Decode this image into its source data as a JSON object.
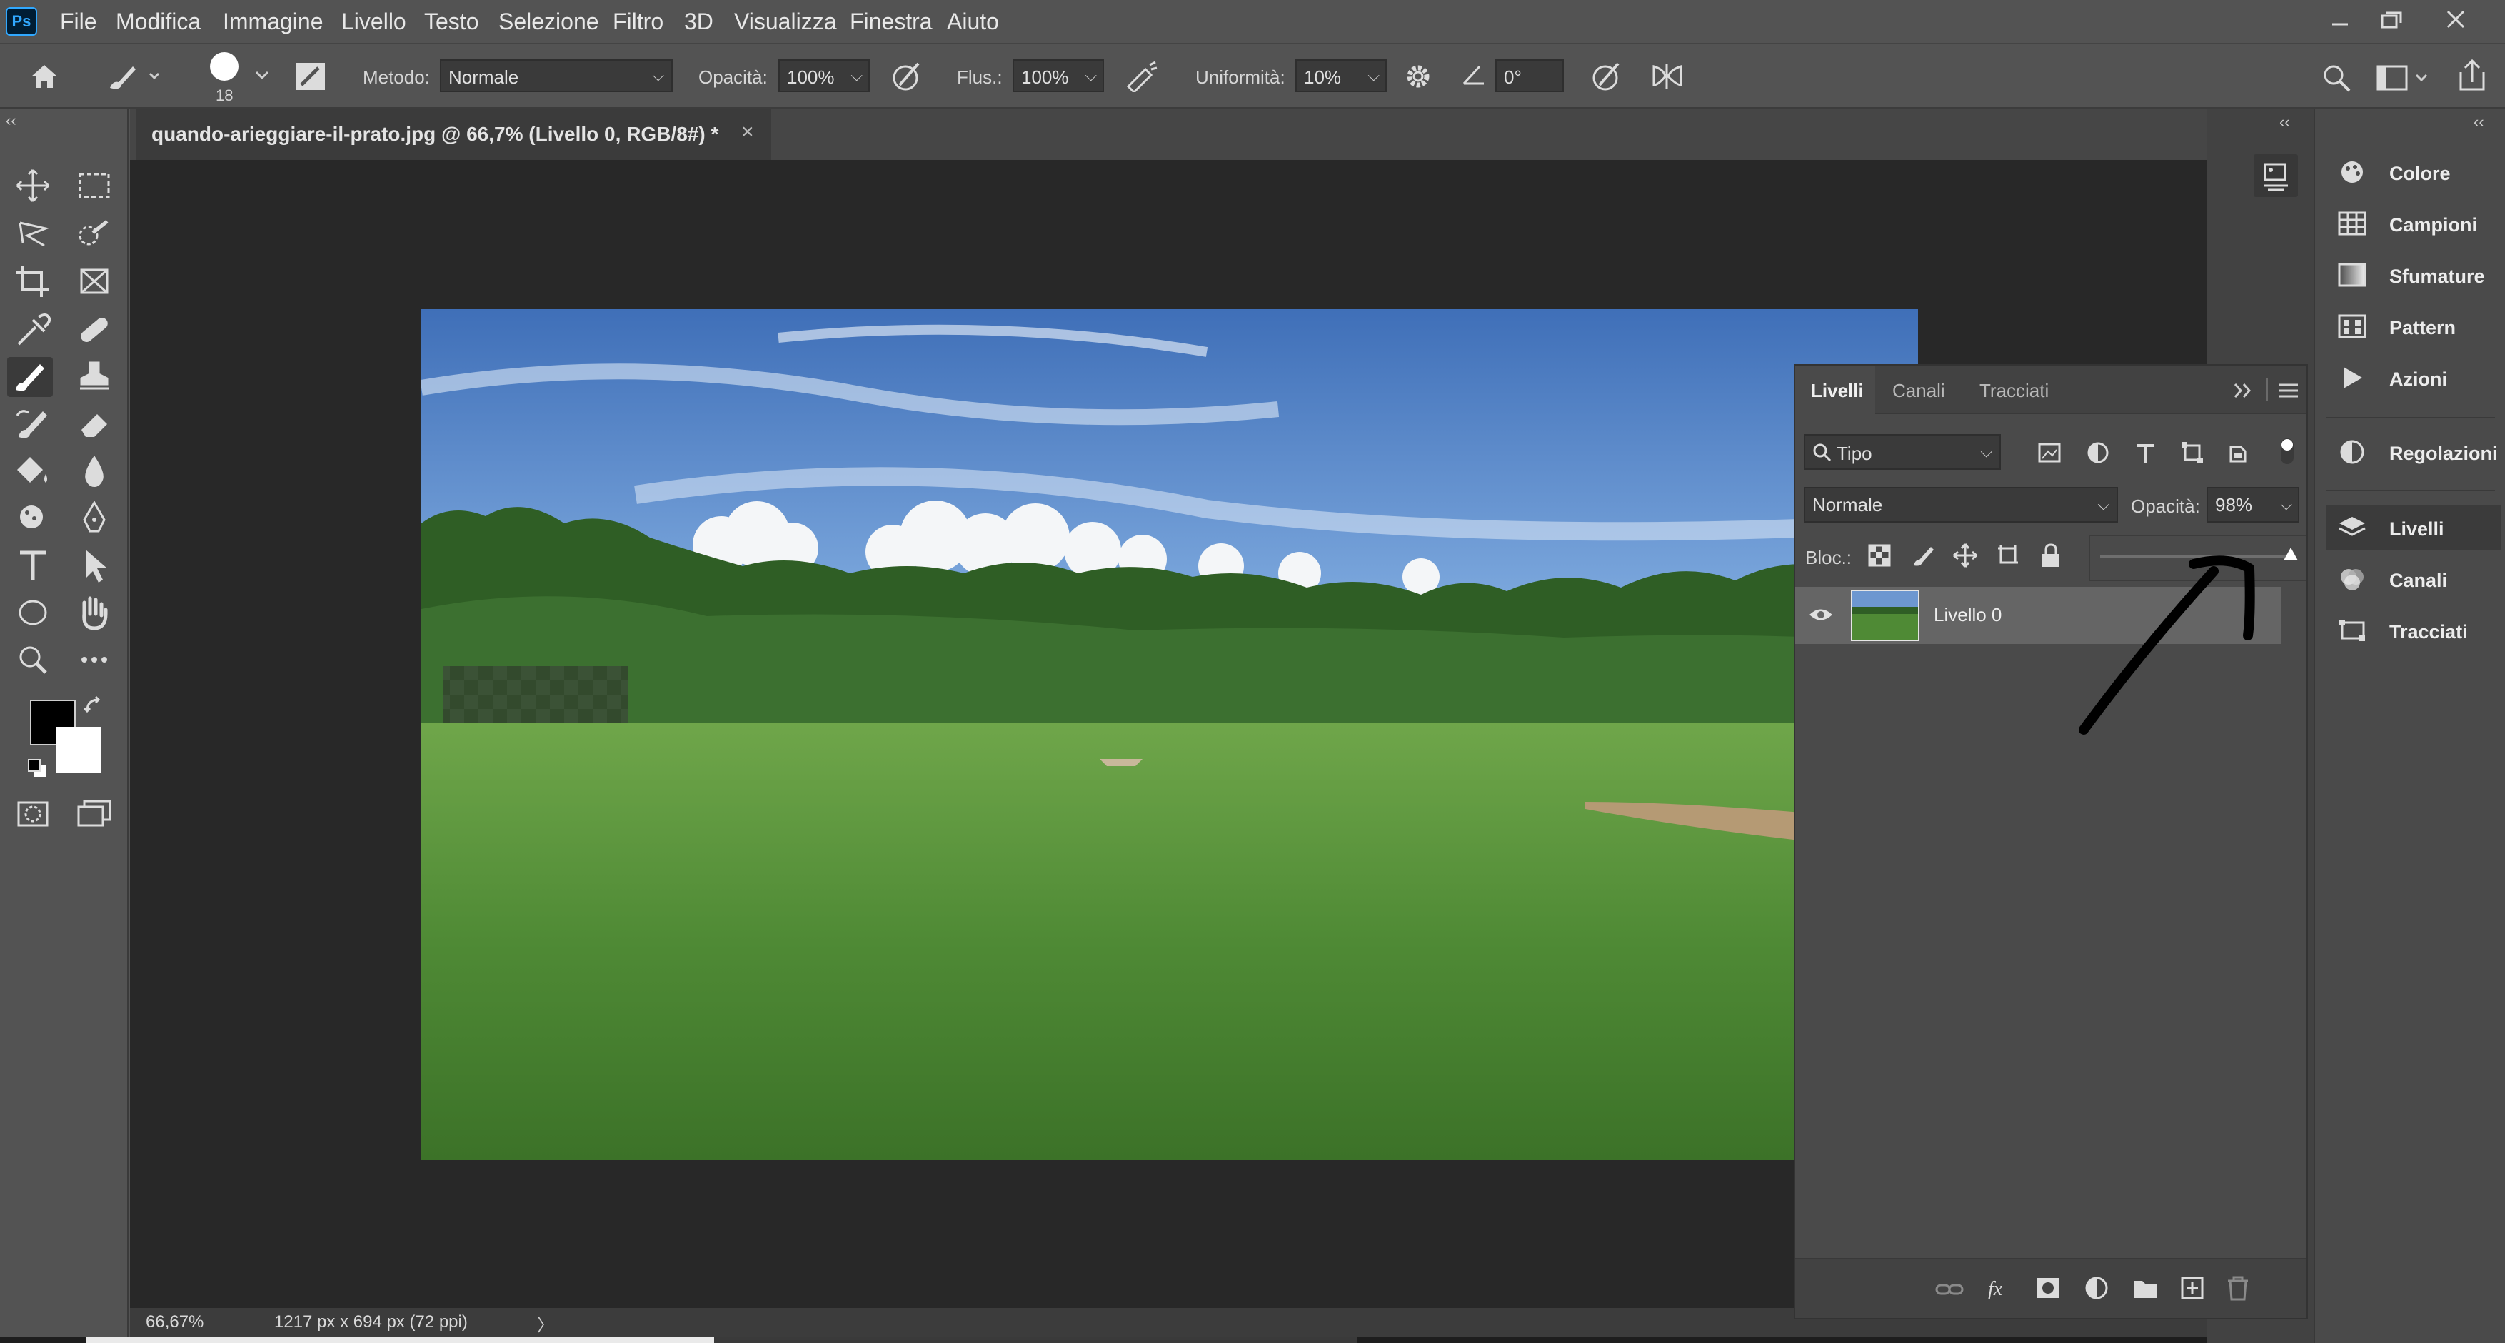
{
  "menu": {
    "logo": "Ps",
    "items": [
      "File",
      "Modifica",
      "Immagine",
      "Livello",
      "Testo",
      "Selezione",
      "Filtro",
      "3D",
      "Visualizza",
      "Finestra",
      "Aiuto"
    ]
  },
  "options": {
    "brush_size": "18",
    "metodo_label": "Metodo:",
    "metodo_value": "Normale",
    "opacita_label": "Opacità:",
    "opacita_value": "100%",
    "flusso_label": "Flus.:",
    "flusso_value": "100%",
    "uniformita_label": "Uniformità:",
    "uniformita_value": "10%",
    "angle_value": "0°"
  },
  "document": {
    "tab_title": "quando-arieggiare-il-prato.jpg @ 66,7% (Livello 0, RGB/8#) *",
    "tab_close": "×",
    "zoom": "66,67%",
    "doc_info": "1217 px x 694 px (72 ppi)",
    "status_arrow": "〉"
  },
  "right_dock": {
    "collapse": "‹‹",
    "items": [
      {
        "label": "Colore",
        "icon": "color-wheel-icon"
      },
      {
        "label": "Campioni",
        "icon": "swatches-grid-icon"
      },
      {
        "label": "Sfumature",
        "icon": "gradient-icon"
      },
      {
        "label": "Pattern",
        "icon": "pattern-icon"
      },
      {
        "label": "Azioni",
        "icon": "play-icon"
      },
      {
        "label": "Regolazioni",
        "icon": "adjustment-circle-icon"
      },
      {
        "label": "Livelli",
        "icon": "layers-stack-icon",
        "selected": true
      },
      {
        "label": "Canali",
        "icon": "channels-icon"
      },
      {
        "label": "Tracciati",
        "icon": "paths-icon"
      }
    ]
  },
  "layers_panel": {
    "tabs": [
      "Livelli",
      "Canali",
      "Tracciati"
    ],
    "active_tab": "Livelli",
    "filter_value": "Tipo",
    "blend_mode": "Normale",
    "opacity_label": "Opacità:",
    "opacity_value": "98%",
    "opacity_slider_fraction": 0.98,
    "lock_label": "Bloc.:",
    "layers": [
      {
        "name": "Livello 0",
        "visible": true
      }
    ]
  },
  "colors": {
    "ui_bg": "#535353",
    "canvas_bg": "#282828",
    "foreground": "#000000",
    "background": "#ffffff"
  }
}
